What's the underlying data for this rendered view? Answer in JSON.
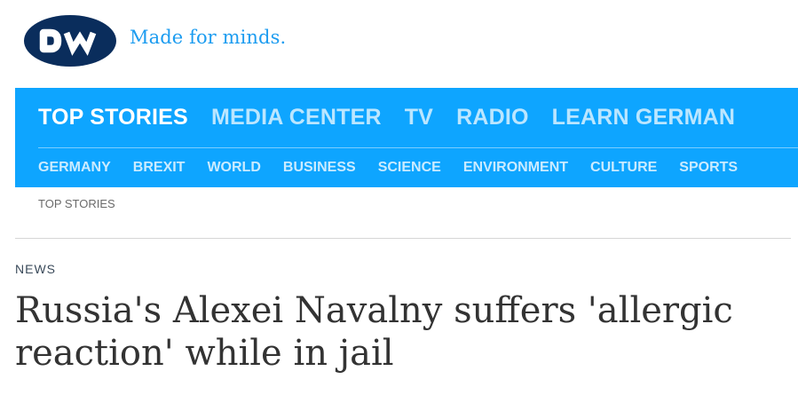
{
  "colors": {
    "brand_blue": "#0ea5ff",
    "logo_navy": "#0a2d5c",
    "tagline_blue": "#1c9cf0",
    "headline_text": "#333333",
    "kicker_text": "#3a4a5a"
  },
  "brand": {
    "logo_text": "DW",
    "tagline": "Made for minds."
  },
  "nav": {
    "main": [
      {
        "label": "TOP STORIES"
      },
      {
        "label": "MEDIA CENTER"
      },
      {
        "label": "TV"
      },
      {
        "label": "RADIO"
      },
      {
        "label": "LEARN GERMAN"
      }
    ],
    "sub": [
      {
        "label": "GERMANY"
      },
      {
        "label": "BREXIT"
      },
      {
        "label": "WORLD"
      },
      {
        "label": "BUSINESS"
      },
      {
        "label": "SCIENCE"
      },
      {
        "label": "ENVIRONMENT"
      },
      {
        "label": "CULTURE"
      },
      {
        "label": "SPORTS"
      }
    ]
  },
  "breadcrumb": "TOP STORIES",
  "article": {
    "kicker": "NEWS",
    "headline": "Russia's Alexei Navalny suffers 'allergic reaction' while in jail"
  }
}
